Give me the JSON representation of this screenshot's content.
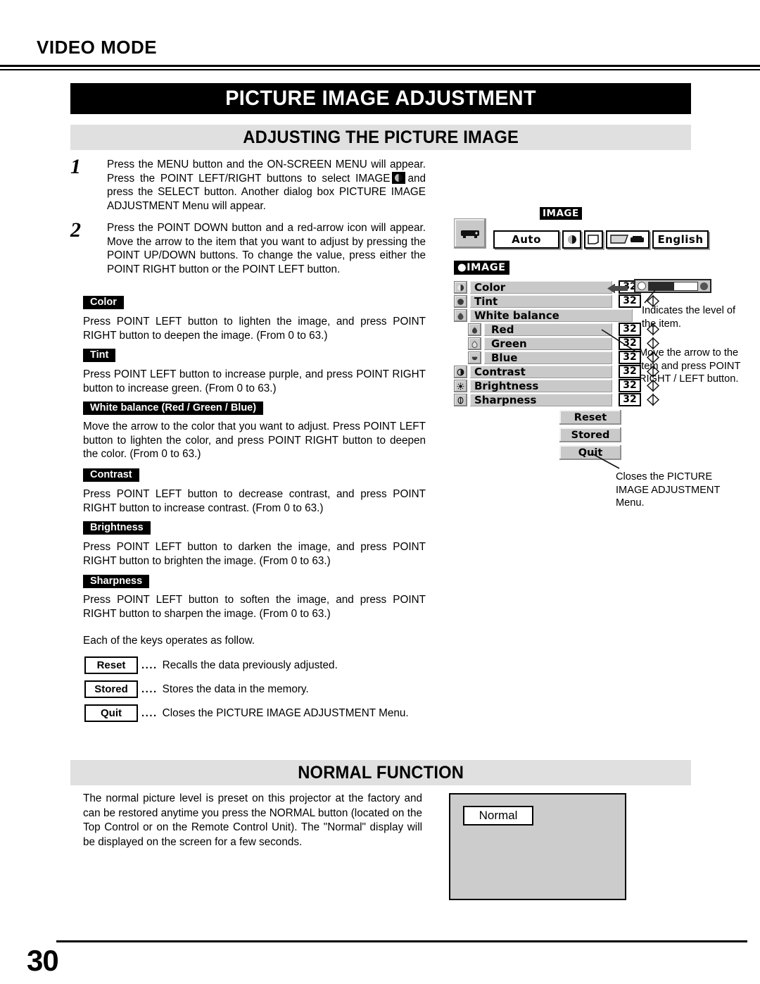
{
  "header": {
    "mode_label": "VIDEO MODE",
    "title": "PICTURE IMAGE ADJUSTMENT"
  },
  "sections": {
    "adjusting": "ADJUSTING THE PICTURE IMAGE",
    "normal": "NORMAL FUNCTION"
  },
  "steps": [
    {
      "number": "1",
      "text_before_icon": "Press the MENU button and the ON-SCREEN MENU will appear.  Press the POINT LEFT/RIGHT buttons to select IMAGE",
      "text_after_icon": "and press the SELECT button.  Another dialog box PICTURE IMAGE ADJUSTMENT Menu will appear."
    },
    {
      "number": "2",
      "text": "Press the POINT DOWN button and a red-arrow icon will appear.  Move the arrow to the item that you want to adjust by pressing the POINT UP/DOWN buttons.  To change the value, press either the POINT RIGHT button or the POINT LEFT button."
    }
  ],
  "items": [
    {
      "label": "Color",
      "desc": "Press POINT LEFT button to lighten the image, and press POINT RIGHT button to deepen the image.  (From 0 to 63.)"
    },
    {
      "label": "Tint",
      "desc": "Press POINT LEFT button to increase purple, and press POINT RIGHT button to increase green.  (From 0 to 63.)"
    },
    {
      "label": "White balance (Red / Green / Blue)",
      "desc": "Move the arrow to the color that you want to adjust.  Press POINT LEFT button to lighten the color, and press POINT RIGHT button to deepen the color.  (From 0 to 63.)"
    },
    {
      "label": "Contrast",
      "desc": "Press POINT LEFT button to decrease contrast, and press POINT RIGHT button to increase contrast.  (From 0 to 63.)"
    },
    {
      "label": "Brightness",
      "desc": "Press POINT LEFT button to darken the image, and press POINT RIGHT button to brighten the image.  (From 0 to 63.)"
    },
    {
      "label": "Sharpness",
      "desc": "Press POINT LEFT button to soften the image, and press POINT RIGHT button to sharpen the image.  (From 0 to 63.)"
    }
  ],
  "keys_intro": "Each of the keys operates as follow.",
  "keys": [
    {
      "name": "Reset",
      "dots": "....",
      "desc": "Recalls the data previously adjusted."
    },
    {
      "name": "Stored",
      "dots": "....",
      "desc": "Stores the data in the memory."
    },
    {
      "name": "Quit",
      "dots": "....",
      "desc": "Closes the PICTURE IMAGE ADJUSTMENT Menu."
    }
  ],
  "osd": {
    "toolbar": {
      "image_tag": "IMAGE",
      "auto_label": "Auto",
      "language_label": "English"
    },
    "menu_title": "IMAGE",
    "rows": [
      {
        "label": "Color",
        "value": "32",
        "icon": "color-icon",
        "sub": false,
        "wide": false
      },
      {
        "label": "Tint",
        "value": "32",
        "icon": "tint-icon",
        "sub": false,
        "wide": false
      },
      {
        "label": "White balance",
        "value": "",
        "icon": "whitebalance-icon",
        "sub": false,
        "wide": true
      },
      {
        "label": "Red",
        "value": "32",
        "icon": "red-icon",
        "sub": true,
        "wide": false
      },
      {
        "label": "Green",
        "value": "32",
        "icon": "green-icon",
        "sub": true,
        "wide": false
      },
      {
        "label": "Blue",
        "value": "32",
        "icon": "blue-icon",
        "sub": true,
        "wide": false
      },
      {
        "label": "Contrast",
        "value": "32",
        "icon": "contrast-icon",
        "sub": false,
        "wide": false
      },
      {
        "label": "Brightness",
        "value": "32",
        "icon": "brightness-icon",
        "sub": false,
        "wide": false
      },
      {
        "label": "Sharpness",
        "value": "32",
        "icon": "sharpness-icon",
        "sub": false,
        "wide": false
      }
    ],
    "buttons": [
      {
        "label": "Reset"
      },
      {
        "label": "Stored"
      },
      {
        "label": "Quit"
      }
    ],
    "notes": {
      "level": "Indicates the level of the item.",
      "move": "Move the arrow to the item and press POINT RIGHT / LEFT button.",
      "quit": "Closes the PICTURE IMAGE ADJUSTMENT Menu."
    }
  },
  "normal_function": {
    "text": "The normal picture level is preset on this projector at the factory and can be restored anytime you press the NORMAL button (located on the Top Control or on the Remote Control Unit).  The \"Normal\" display will be displayed on the screen for a few seconds.",
    "badge": "Normal"
  },
  "footer": {
    "page_number": "30"
  }
}
